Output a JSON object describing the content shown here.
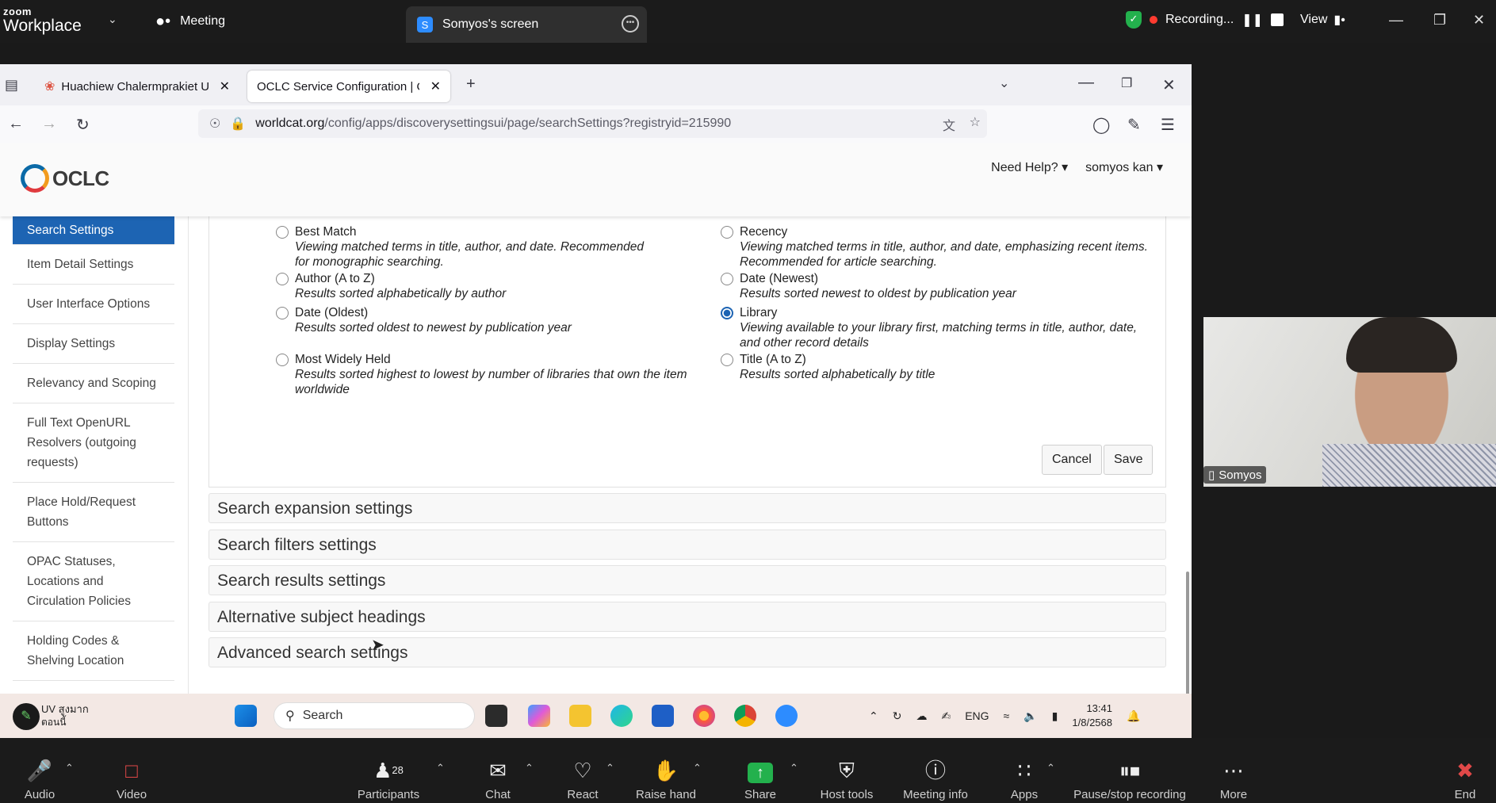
{
  "zoom": {
    "brand_small": "zoom",
    "brand_big": "Workplace",
    "meeting_label": "Meeting",
    "share_tab_letter": "S",
    "share_tab_title": "Somyos's screen",
    "recording_label": "Recording...",
    "view_label": "View",
    "participant_count": "28",
    "toolbar": {
      "audio": "Audio",
      "video": "Video",
      "participants": "Participants",
      "chat": "Chat",
      "react": "React",
      "raise_hand": "Raise hand",
      "share": "Share",
      "host_tools": "Host tools",
      "meeting_info": "Meeting info",
      "apps": "Apps",
      "pause_stop": "Pause/stop recording",
      "more": "More",
      "end": "End"
    },
    "video_name": "Somyos"
  },
  "browser": {
    "tabs": [
      {
        "title": "Huachiew Chalermprakiet Unive"
      },
      {
        "title": "OCLC Service Configuration | OCLC"
      }
    ],
    "url_domain": "worldcat.org",
    "url_path": "/config/apps/discoverysettingsui/page/searchSettings?registryid=215990"
  },
  "oclc": {
    "logo_text": "OCLC",
    "need_help": "Need Help?",
    "user": "somyos kan",
    "sidebar": [
      "Search Settings",
      "Item Detail Settings",
      "User Interface Options",
      "Display Settings",
      "Relevancy and Scoping",
      "Full Text OpenURL Resolvers (outgoing requests)",
      "Place Hold/Request Buttons",
      "OPAC Statuses, Locations and Circulation Policies",
      "Holding Codes & Shelving Location"
    ],
    "sort_options": [
      {
        "label": "Best Match",
        "desc": "Viewing matched terms in title, author, and date. Recommended for monographic searching.",
        "selected": false
      },
      {
        "label": "Recency",
        "desc": "Viewing matched terms in title, author, and date, emphasizing recent items. Recommended for article searching.",
        "selected": false
      },
      {
        "label": "Author (A to Z)",
        "desc": "Results sorted alphabetically by author",
        "selected": false
      },
      {
        "label": "Date (Newest)",
        "desc": "Results sorted newest to oldest by publication year",
        "selected": false
      },
      {
        "label": "Date (Oldest)",
        "desc": "Results sorted oldest to newest by publication year",
        "selected": false
      },
      {
        "label": "Library",
        "desc": "Viewing available to your library first, matching terms in title, author, date, and other record details",
        "selected": true
      },
      {
        "label": "Most Widely Held",
        "desc": "Results sorted highest to lowest by number of libraries that own the item worldwide",
        "selected": false
      },
      {
        "label": "Title (A to Z)",
        "desc": "Results sorted alphabetically by title",
        "selected": false
      }
    ],
    "cancel": "Cancel",
    "save": "Save",
    "accordions": [
      "Search expansion settings",
      "Search filters settings",
      "Search results settings",
      "Alternative subject headings",
      "Advanced search settings"
    ]
  },
  "taskbar": {
    "weather_line1": "UV สูงมาก",
    "weather_line2": "ตอนนี้",
    "search": "Search",
    "lang": "ENG",
    "time": "13:41",
    "date": "1/8/2568"
  }
}
